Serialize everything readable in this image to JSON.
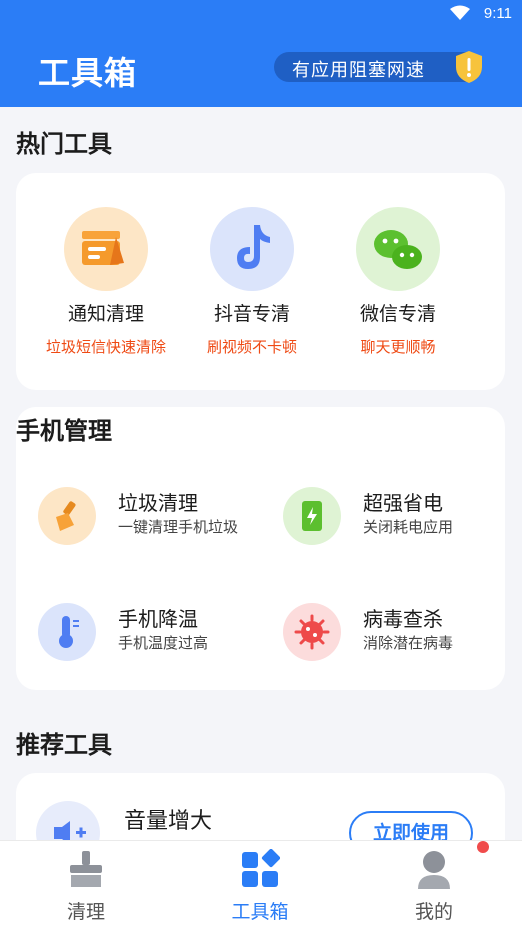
{
  "status": {
    "time": "9:11"
  },
  "header": {
    "title": "工具箱",
    "pill_text": "有应用阻塞网速"
  },
  "sections": {
    "hot": "热门工具",
    "manage": "手机管理",
    "recommend": "推荐工具"
  },
  "hot_tools": [
    {
      "name": "通知清理",
      "sub": "垃圾短信快速清除",
      "icon": "notification-clean-icon"
    },
    {
      "name": "抖音专清",
      "sub": "刷视频不卡顿",
      "icon": "tiktok-icon"
    },
    {
      "name": "微信专清",
      "sub": "聊天更顺畅",
      "icon": "wechat-icon"
    }
  ],
  "manage_tools": [
    {
      "name": "垃圾清理",
      "desc": "一键清理手机垃圾",
      "icon": "broom-icon"
    },
    {
      "name": "超强省电",
      "desc": "关闭耗电应用",
      "icon": "battery-icon"
    },
    {
      "name": "手机降温",
      "desc": "手机温度过高",
      "icon": "thermometer-icon"
    },
    {
      "name": "病毒查杀",
      "desc": "消除潜在病毒",
      "icon": "virus-icon"
    }
  ],
  "recommend": {
    "name": "音量增大",
    "button": "立即使用",
    "icon": "speaker-icon"
  },
  "tabs": [
    {
      "label": "清理",
      "icon": "broom-icon"
    },
    {
      "label": "工具箱",
      "icon": "toolbox-icon"
    },
    {
      "label": "我的",
      "icon": "user-icon"
    }
  ],
  "colors": {
    "brand": "#2b7df6",
    "accent_orange": "#ef4a14",
    "badge_red": "#f04b4b"
  }
}
